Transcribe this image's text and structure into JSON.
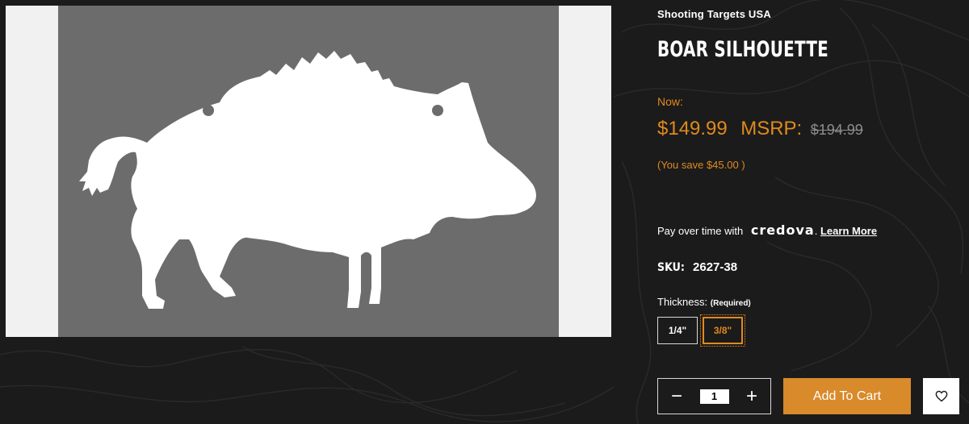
{
  "product": {
    "brand": "Shooting Targets USA",
    "title": "BOAR SILHOUETTE",
    "now_label": "Now:",
    "price_now": "$149.99",
    "msrp_label": "MSRP:",
    "msrp_value": "$194.99",
    "you_save": "(You save $45.00 )",
    "image_alt": "boar silhouette target"
  },
  "financing": {
    "text": "Pay over time with",
    "provider": "credova",
    "separator": ".",
    "learn_more": "Learn More"
  },
  "sku": {
    "label": "SKU:",
    "value": "2627-38"
  },
  "thickness": {
    "label": "Thickness:",
    "required": "(Required)",
    "options": [
      "1/4\"",
      "3/8\""
    ],
    "selected": "3/8\""
  },
  "cart": {
    "quantity": "1",
    "minus_icon": "minus-icon",
    "plus_icon": "plus-icon",
    "add_to_cart": "Add To Cart",
    "wishlist_icon": "heart-icon"
  },
  "colors": {
    "accent": "#e08a1e",
    "button": "#d98a2b",
    "background": "#1b1b1b"
  }
}
